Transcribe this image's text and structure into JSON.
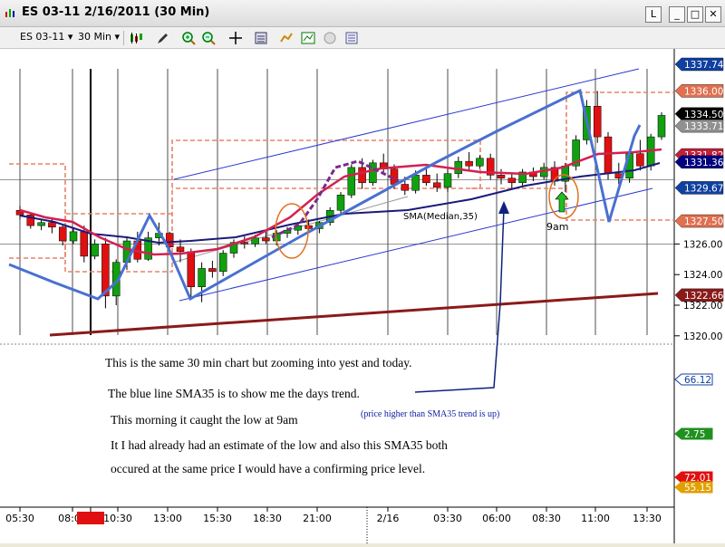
{
  "window": {
    "title": "ES 03-11  2/16/2011  (30 Min)",
    "buttons": [
      "L",
      "_",
      "□",
      "✕"
    ]
  },
  "toolbar": {
    "symbol": "ES 03-11",
    "interval": "30 Min",
    "icons": [
      "candlestick-icon",
      "pen-icon",
      "zoom-in-icon",
      "zoom-out-icon",
      "crosshair-icon",
      "data-box-icon",
      "indicator-icon",
      "chart-type-icon",
      "circle-icon",
      "properties-icon"
    ]
  },
  "chart_data": {
    "type": "candlestick",
    "x_tick_labels": [
      "05:30",
      "08:00",
      "09:00",
      "10:30",
      "13:00",
      "15:30",
      "18:30",
      "21:00",
      "2/16",
      "03:30",
      "06:00",
      "08:30",
      "11:00",
      "13:30"
    ],
    "y_tick_labels": [
      "1320.00",
      "1322.00",
      "1324.00",
      "1326.00"
    ],
    "ylim": [
      1319,
      1339
    ],
    "price_labels": [
      {
        "text": "1337.74",
        "value": 1337.74,
        "color": "#1040a0"
      },
      {
        "text": "1336.00",
        "value": 1336.0,
        "color": "#e07050"
      },
      {
        "text": "1334.50",
        "value": 1334.5,
        "color": "#000000"
      },
      {
        "text": "1333.71",
        "value": 1333.71,
        "color": "#909090"
      },
      {
        "text": "1331.82",
        "value": 1331.82,
        "color": "#c0203c"
      },
      {
        "text": "1331.36",
        "value": 1331.36,
        "color": "#000080"
      },
      {
        "text": "1329.67",
        "value": 1329.67,
        "color": "#1040a0"
      },
      {
        "text": "1327.50",
        "value": 1327.5,
        "color": "#e07050"
      },
      {
        "text": "1322.66",
        "value": 1322.66,
        "color": "#8b1a1a"
      }
    ],
    "lower_labels": [
      {
        "text": "66.12",
        "color": "#1040a0"
      },
      {
        "text": "2.75",
        "color": "#209020"
      },
      {
        "text": "72.01",
        "color": "#e01010"
      },
      {
        "text": "55.15",
        "color": "#e0a000"
      }
    ],
    "highlighted_x_label": "09:00",
    "ohlc": [
      [
        1328.2,
        1328.5,
        1327.6,
        1327.9
      ],
      [
        1327.9,
        1328.0,
        1327.0,
        1327.2
      ],
      [
        1327.2,
        1327.6,
        1326.9,
        1327.4
      ],
      [
        1327.4,
        1327.6,
        1326.7,
        1327.1
      ],
      [
        1327.1,
        1327.2,
        1325.9,
        1326.2
      ],
      [
        1326.2,
        1327.0,
        1326.0,
        1326.8
      ],
      [
        1326.8,
        1327.2,
        1324.8,
        1325.2
      ],
      [
        1325.2,
        1326.3,
        1325.0,
        1326.0
      ],
      [
        1326.0,
        1326.4,
        1321.8,
        1322.6
      ],
      [
        1322.6,
        1325.0,
        1322.0,
        1324.8
      ],
      [
        1324.8,
        1326.5,
        1324.3,
        1326.2
      ],
      [
        1326.2,
        1326.8,
        1324.8,
        1325.0
      ],
      [
        1325.0,
        1326.8,
        1324.9,
        1326.4
      ],
      [
        1326.4,
        1327.4,
        1325.9,
        1326.7
      ],
      [
        1326.7,
        1326.8,
        1325.5,
        1325.8
      ],
      [
        1325.8,
        1326.3,
        1324.8,
        1325.5
      ],
      [
        1325.5,
        1325.7,
        1322.4,
        1323.2
      ],
      [
        1323.2,
        1324.8,
        1322.2,
        1324.4
      ],
      [
        1324.4,
        1324.9,
        1323.8,
        1324.2
      ],
      [
        1324.2,
        1325.6,
        1323.9,
        1325.4
      ],
      [
        1325.4,
        1326.3,
        1325.1,
        1326.1
      ],
      [
        1326.1,
        1326.5,
        1325.7,
        1326.0
      ],
      [
        1326.0,
        1326.6,
        1325.8,
        1326.4
      ],
      [
        1326.4,
        1326.8,
        1326.0,
        1326.2
      ],
      [
        1326.2,
        1326.9,
        1325.9,
        1326.7
      ],
      [
        1326.7,
        1327.1,
        1326.4,
        1326.9
      ],
      [
        1326.9,
        1327.3,
        1326.6,
        1327.2
      ],
      [
        1327.2,
        1327.6,
        1326.8,
        1327.0
      ],
      [
        1327.0,
        1327.5,
        1326.7,
        1327.4
      ],
      [
        1327.4,
        1328.4,
        1327.2,
        1328.2
      ],
      [
        1328.2,
        1329.4,
        1327.9,
        1329.2
      ],
      [
        1329.2,
        1331.2,
        1329.0,
        1331.0
      ],
      [
        1331.0,
        1331.6,
        1329.6,
        1330.0
      ],
      [
        1330.0,
        1331.5,
        1329.8,
        1331.3
      ],
      [
        1331.3,
        1331.9,
        1330.6,
        1330.9
      ],
      [
        1330.9,
        1331.2,
        1329.6,
        1329.9
      ],
      [
        1329.9,
        1330.4,
        1329.2,
        1329.5
      ],
      [
        1329.5,
        1330.8,
        1329.3,
        1330.5
      ],
      [
        1330.5,
        1330.9,
        1329.8,
        1330.0
      ],
      [
        1330.0,
        1330.6,
        1329.4,
        1329.7
      ],
      [
        1329.7,
        1330.9,
        1329.4,
        1330.6
      ],
      [
        1330.6,
        1331.7,
        1330.3,
        1331.4
      ],
      [
        1331.4,
        1332.0,
        1330.8,
        1331.1
      ],
      [
        1331.1,
        1331.8,
        1330.9,
        1331.6
      ],
      [
        1331.6,
        1331.9,
        1330.2,
        1330.5
      ],
      [
        1330.5,
        1330.9,
        1329.9,
        1330.3
      ],
      [
        1330.3,
        1330.6,
        1329.6,
        1330.0
      ],
      [
        1330.0,
        1330.9,
        1329.8,
        1330.7
      ],
      [
        1330.7,
        1331.0,
        1330.1,
        1330.4
      ],
      [
        1330.4,
        1331.3,
        1330.2,
        1331.0
      ],
      [
        1331.0,
        1331.4,
        1329.8,
        1330.1
      ],
      [
        1330.1,
        1331.3,
        1329.4,
        1331.1
      ],
      [
        1331.1,
        1333.1,
        1330.8,
        1332.8
      ],
      [
        1332.8,
        1335.4,
        1332.5,
        1335.0
      ],
      [
        1335.0,
        1336.0,
        1332.6,
        1333.0
      ],
      [
        1333.0,
        1333.3,
        1330.2,
        1330.6
      ],
      [
        1330.6,
        1331.3,
        1329.9,
        1330.3
      ],
      [
        1330.3,
        1332.2,
        1330.0,
        1331.9
      ],
      [
        1331.9,
        1332.8,
        1330.8,
        1331.1
      ],
      [
        1331.1,
        1333.2,
        1330.8,
        1333.0
      ],
      [
        1333.0,
        1334.6,
        1332.8,
        1334.4
      ]
    ],
    "series": [
      {
        "name": "SMA(Median,35)",
        "color": "#1a1a7a"
      }
    ],
    "annotations": {
      "sma_label": "SMA(Median,35)",
      "nine_am_label": "9am",
      "note_lines": [
        "This is the same 30 min chart but zooming into yest and today.",
        "The blue line SMA35 is to show me the days trend.",
        "This morning it caught the low at 9am",
        "It I had already had an estimate of the low and also this SMA35 both",
        "occured at the same price I would have a confirming price level."
      ],
      "side_note": "(price higher than SMA35 trend is up)"
    }
  }
}
